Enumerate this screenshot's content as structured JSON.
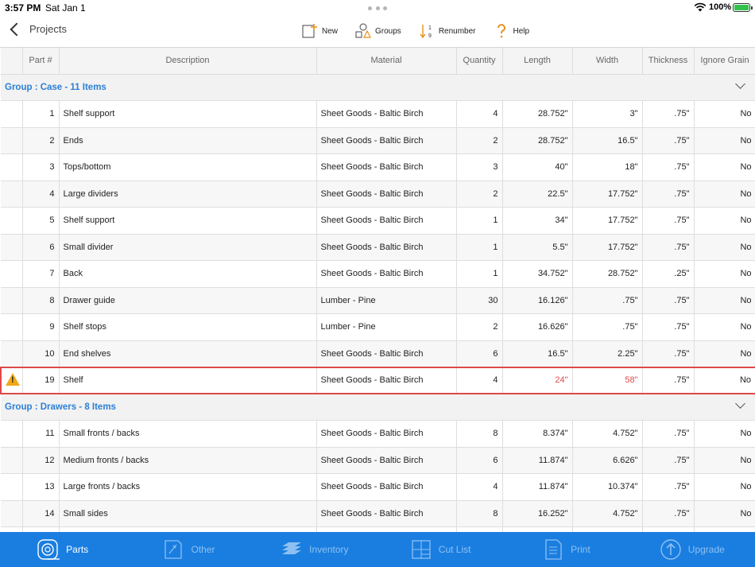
{
  "status_bar": {
    "time": "3:57 PM",
    "date": "Sat Jan 1",
    "battery": "100%"
  },
  "nav": {
    "back_label": "Projects",
    "toolbar": [
      {
        "label": "New",
        "icon": "new-part-icon"
      },
      {
        "label": "Groups",
        "icon": "groups-icon"
      },
      {
        "label": "Renumber",
        "icon": "renumber-icon"
      },
      {
        "label": "Help",
        "icon": "help-icon"
      }
    ]
  },
  "table": {
    "columns": [
      "",
      "Part #",
      "Description",
      "Material",
      "Quantity",
      "Length",
      "Width",
      "Thickness",
      "Ignore Grain"
    ],
    "groups": [
      {
        "title": "Group : Case - 11 Items",
        "rows": [
          {
            "part": "1",
            "desc": "Shelf support",
            "material": "Sheet Goods - Baltic Birch",
            "qty": "4",
            "length": "28.752\"",
            "width": "3\"",
            "thickness": ".75\"",
            "grain": "No"
          },
          {
            "part": "2",
            "desc": "Ends",
            "material": "Sheet Goods - Baltic Birch",
            "qty": "2",
            "length": "28.752\"",
            "width": "16.5\"",
            "thickness": ".75\"",
            "grain": "No"
          },
          {
            "part": "3",
            "desc": "Tops/bottom",
            "material": "Sheet Goods - Baltic Birch",
            "qty": "3",
            "length": "40\"",
            "width": "18\"",
            "thickness": ".75\"",
            "grain": "No"
          },
          {
            "part": "4",
            "desc": "Large dividers",
            "material": "Sheet Goods - Baltic Birch",
            "qty": "2",
            "length": "22.5\"",
            "width": "17.752\"",
            "thickness": ".75\"",
            "grain": "No"
          },
          {
            "part": "5",
            "desc": "Shelf support",
            "material": "Sheet Goods - Baltic Birch",
            "qty": "1",
            "length": "34\"",
            "width": "17.752\"",
            "thickness": ".75\"",
            "grain": "No"
          },
          {
            "part": "6",
            "desc": "Small divider",
            "material": "Sheet Goods - Baltic Birch",
            "qty": "1",
            "length": "5.5\"",
            "width": "17.752\"",
            "thickness": ".75\"",
            "grain": "No"
          },
          {
            "part": "7",
            "desc": "Back",
            "material": "Sheet Goods - Baltic Birch",
            "qty": "1",
            "length": "34.752\"",
            "width": "28.752\"",
            "thickness": ".25\"",
            "grain": "No"
          },
          {
            "part": "8",
            "desc": "Drawer guide",
            "material": "Lumber - Pine",
            "qty": "30",
            "length": "16.126\"",
            "width": ".75\"",
            "thickness": ".75\"",
            "grain": "No"
          },
          {
            "part": "9",
            "desc": "Shelf stops",
            "material": "Lumber - Pine",
            "qty": "2",
            "length": "16.626\"",
            "width": ".75\"",
            "thickness": ".75\"",
            "grain": "No"
          },
          {
            "part": "10",
            "desc": "End shelves",
            "material": "Sheet Goods - Baltic Birch",
            "qty": "6",
            "length": "16.5\"",
            "width": "2.25\"",
            "thickness": ".75\"",
            "grain": "No"
          },
          {
            "part": "19",
            "desc": "Shelf",
            "material": "Sheet Goods - Baltic Birch",
            "qty": "4",
            "length": "24\"",
            "width": "58\"",
            "thickness": ".75\"",
            "grain": "No",
            "warning": true
          }
        ]
      },
      {
        "title": "Group : Drawers - 8 Items",
        "rows": [
          {
            "part": "11",
            "desc": "Small fronts / backs",
            "material": "Sheet Goods - Baltic Birch",
            "qty": "8",
            "length": "8.374\"",
            "width": "4.752\"",
            "thickness": ".75\"",
            "grain": "No"
          },
          {
            "part": "12",
            "desc": "Medium fronts / backs",
            "material": "Sheet Goods - Baltic Birch",
            "qty": "6",
            "length": "11.874\"",
            "width": "6.626\"",
            "thickness": ".75\"",
            "grain": "No"
          },
          {
            "part": "13",
            "desc": "Large fronts / backs",
            "material": "Sheet Goods - Baltic Birch",
            "qty": "4",
            "length": "11.874\"",
            "width": "10.374\"",
            "thickness": ".75\"",
            "grain": "No"
          },
          {
            "part": "14",
            "desc": "Small sides",
            "material": "Sheet Goods - Baltic Birch",
            "qty": "8",
            "length": "16.252\"",
            "width": "4.752\"",
            "thickness": ".75\"",
            "grain": "No"
          },
          {
            "part": "",
            "desc": "",
            "material": "",
            "qty": "",
            "length": "",
            "width": "",
            "thickness": "",
            "grain": ""
          }
        ]
      }
    ]
  },
  "tab_bar": [
    {
      "label": "Parts",
      "icon": "tape-measure-icon",
      "active": true
    },
    {
      "label": "Other",
      "icon": "other-icon",
      "active": false
    },
    {
      "label": "Inventory",
      "icon": "inventory-icon",
      "active": false
    },
    {
      "label": "Cut List",
      "icon": "cut-list-icon",
      "active": false
    },
    {
      "label": "Print",
      "icon": "print-icon",
      "active": false
    },
    {
      "label": "Upgrade",
      "icon": "upgrade-icon",
      "active": false
    }
  ],
  "colors": {
    "accent": "#1a7ee0",
    "group_text": "#2b7fd6",
    "warning": "#e04848",
    "warning_icon": "#f0a818"
  }
}
